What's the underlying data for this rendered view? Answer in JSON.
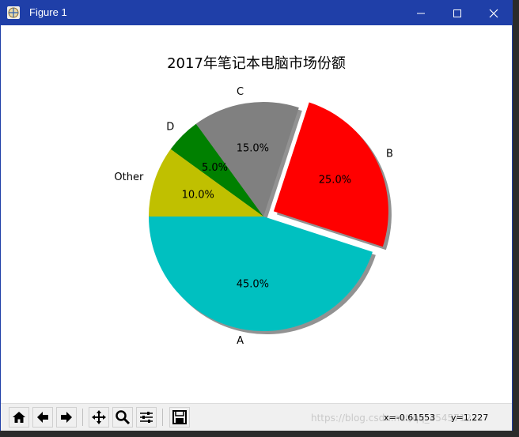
{
  "window": {
    "title": "Figure 1"
  },
  "chart_data": {
    "type": "pie",
    "title": "2017年笔记本电脑市场份额",
    "labels": [
      "A",
      "B",
      "C",
      "D",
      "Other"
    ],
    "values": [
      45,
      25,
      15,
      5,
      10
    ],
    "percent_labels": [
      "45.0%",
      "25.0%",
      "15.0%",
      "5.0%",
      "10.0%"
    ],
    "colors": [
      "#00c0c0",
      "#ff0000",
      "#808080",
      "#008000",
      "#c0c000"
    ],
    "explode": [
      0,
      0.1,
      0,
      0,
      0
    ],
    "shadow": true,
    "start_angle_deg": 180,
    "direction": "counterclockwise",
    "legend": "none"
  },
  "toolbar": {
    "buttons": [
      "home-icon",
      "back-icon",
      "forward-icon",
      "pan-icon",
      "zoom-icon",
      "configure-subplots-icon",
      "save-icon"
    ],
    "coord_x": "x=-0.61553",
    "coord_y": "y=1.227",
    "watermark": "https://blog.csdn.net/qq_45457122"
  }
}
